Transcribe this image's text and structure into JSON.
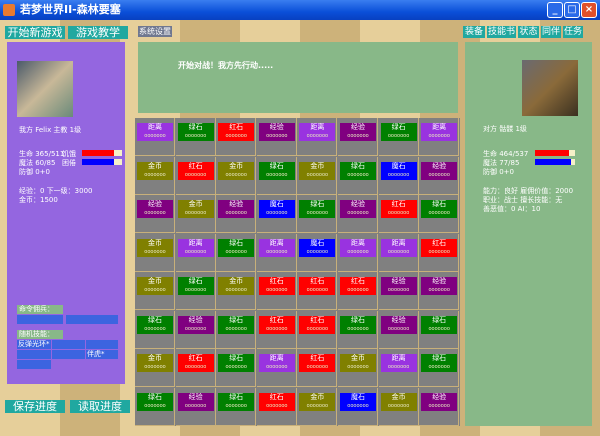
{
  "window": {
    "title": "若梦世界II-森林要塞",
    "min": "_",
    "max": "□",
    "close": "×"
  },
  "menu": {
    "new_game": "开始新游戏",
    "tutorial": "游戏教学",
    "settings": "系统设置",
    "save": "保存进度",
    "load": "读取进度"
  },
  "tabs": [
    "装备",
    "技能书",
    "状态",
    "同伴",
    "任务"
  ],
  "message": "开始对战！我方先行动.....",
  "player": {
    "header": "我方  Felix 主教 1级",
    "hp": "生命 365/511",
    "hunger": "饥饿",
    "mp": "魔法 60/85",
    "sleepy": "困倦",
    "defense": "防御 0+0",
    "exp": "经验：0 下一级：3000",
    "gold": "金币：1500",
    "hunger_pct": 80,
    "sleepy_pct": 80,
    "command_label": "命令佣兵：",
    "skills_label": "随机技能：",
    "skill1": "反弹光环*",
    "skill2": "伴虎*"
  },
  "enemy": {
    "header": "对方  骷髅 1级",
    "hp": "生命 464/537",
    "mp": "魔法 77/85",
    "defense": "防御 0+0",
    "ability": "能力：良好 雇佣价值：2000",
    "job": "职业：战士 擅长技能：无",
    "karma": "善恶值：0    AI：10",
    "hp_pct": 86,
    "mp_pct": 90
  },
  "tile_dots": "ooooooo",
  "tile_colors": {
    "距离": "#9933e0",
    "绿石": "#008000",
    "红石": "#ff0000",
    "经验": "#800080",
    "金币": "#808000",
    "魔石": "#0000ff"
  },
  "board": [
    [
      "距离",
      "绿石",
      "红石",
      "经验",
      "距离",
      "经验",
      "绿石",
      "距离"
    ],
    [
      "金币",
      "红石",
      "金币",
      "绿石",
      "金币",
      "绿石",
      "魔石",
      "经验"
    ],
    [
      "经验",
      "金币",
      "经验",
      "魔石",
      "绿石",
      "经验",
      "红石",
      "绿石"
    ],
    [
      "金币",
      "距离",
      "绿石",
      "距离",
      "魔石",
      "距离",
      "距离",
      "红石"
    ],
    [
      "金币",
      "绿石",
      "金币",
      "红石",
      "红石",
      "红石",
      "经验",
      "经验"
    ],
    [
      "绿石",
      "经验",
      "绿石",
      "红石",
      "红石",
      "绿石",
      "经验",
      "绿石"
    ],
    [
      "金币",
      "红石",
      "绿石",
      "距离",
      "红石",
      "金币",
      "距离",
      "绿石"
    ],
    [
      "绿石",
      "经验",
      "绿石",
      "红石",
      "金币",
      "魔石",
      "金币",
      "经验"
    ]
  ]
}
